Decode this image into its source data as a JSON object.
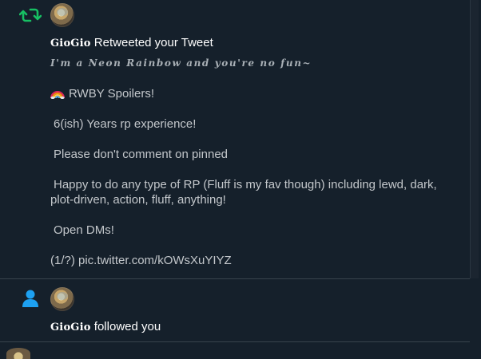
{
  "notifications": [
    {
      "type_icon": "retweet-icon",
      "actor": "GioGio",
      "action": "Retweeted your Tweet",
      "tweet_lines": [
        "I'm a Neon Rainbow and you're no fun~",
        "RWBY Spoilers!",
        "6(ish) Years rp experience!",
        "Please don't comment on pinned",
        "Happy to do any type of RP (Fluff is my fav though) including lewd, dark, plot-driven, action, fluff, anything!",
        "Open DMs!",
        "(1/?) pic.twitter.com/kOWsXuYIYZ"
      ]
    },
    {
      "type_icon": "person-icon",
      "actor": "GioGio",
      "action": "followed you"
    }
  ],
  "colors": {
    "background": "#15202b",
    "retweet_green": "#17bf63",
    "follow_blue": "#1da1f2",
    "divider": "#38444d"
  }
}
